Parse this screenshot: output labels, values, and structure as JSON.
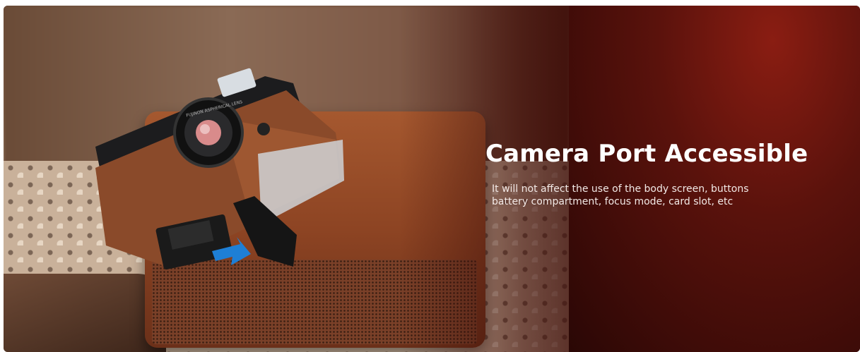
{
  "banner": {
    "headline": "Camera Port Accessible",
    "description_lines": [
      "It will not affect the use of the body screen, buttons",
      "battery compartment, focus mode, card slot, etc"
    ],
    "lens_ring_text": "FUJINON ASPHERICAL LENS",
    "colors": {
      "background_red": "#5a120c",
      "headline": "#ffffff",
      "arrow_blue": "#1e7fd6"
    }
  }
}
